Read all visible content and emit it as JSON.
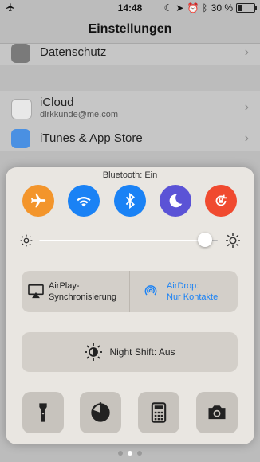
{
  "status_bar": {
    "time": "14:48",
    "battery_text": "30 %",
    "battery_level": 0.3
  },
  "settings": {
    "title": "Einstellungen",
    "rows": [
      {
        "label": "Datenschutz"
      },
      {
        "label": "iCloud",
        "sublabel": "dirkkunde@me.com"
      },
      {
        "label": "iTunes & App Store"
      }
    ]
  },
  "control_center": {
    "bluetooth_status": "Bluetooth: Ein",
    "toggles": [
      {
        "name": "airplane",
        "color": "#f3952b"
      },
      {
        "name": "wifi",
        "color": "#1a82f5"
      },
      {
        "name": "bluetooth",
        "color": "#1a82f5"
      },
      {
        "name": "do-not-disturb",
        "color": "#5b53d6"
      },
      {
        "name": "rotation-lock",
        "color": "#f04a2f"
      }
    ],
    "brightness": 0.93,
    "airplay": {
      "label": "AirPlay-\nSynchronisierung"
    },
    "airdrop": {
      "label": "AirDrop:\nNur Kontakte",
      "color": "#1a82f5"
    },
    "night_shift": {
      "label": "Night Shift: Aus"
    },
    "bottom_buttons": [
      "flashlight",
      "timer",
      "calculator",
      "camera"
    ]
  },
  "page_indicator": {
    "pages": 3,
    "current": 1
  }
}
